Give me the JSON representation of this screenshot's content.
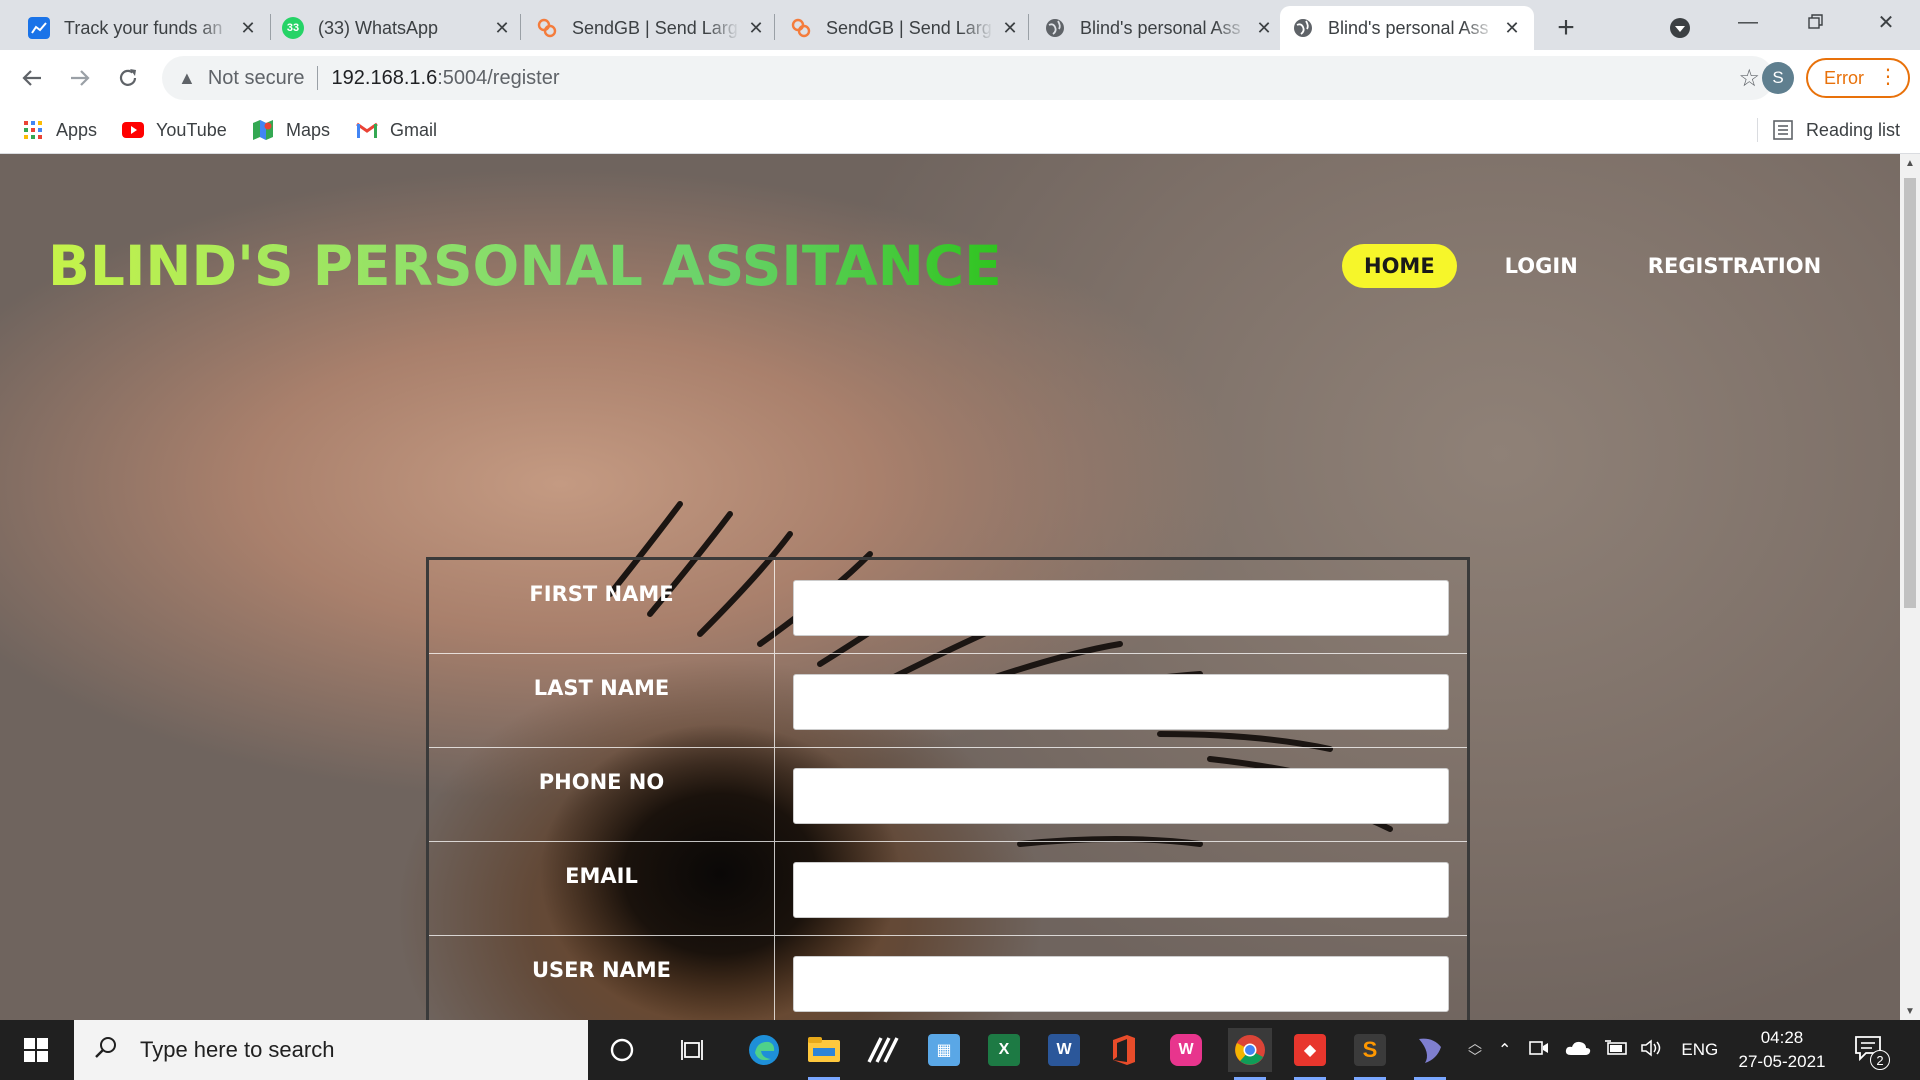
{
  "browser": {
    "tabs": [
      {
        "title": "Track your funds an",
        "favicon": "chart-favicon",
        "color": "#1a73e8",
        "active": false
      },
      {
        "title": "(33) WhatsApp",
        "favicon": "whatsapp-favicon",
        "badge": "33",
        "color": "#25d366",
        "active": false
      },
      {
        "title": "SendGB | Send Larg",
        "favicon": "sendgb-favicon",
        "color": "#f47c3c",
        "active": false
      },
      {
        "title": "SendGB | Send Larg",
        "favicon": "sendgb-favicon",
        "color": "#f47c3c",
        "active": false
      },
      {
        "title": "Blind's personal Ass",
        "favicon": "globe-favicon",
        "color": "#5f6368",
        "active": false
      },
      {
        "title": "Blind's personal Ass",
        "favicon": "globe-favicon",
        "color": "#5f6368",
        "active": true
      }
    ],
    "address": {
      "security": "Not secure",
      "host": "192.168.1.6",
      "path": ":5004/register"
    },
    "profile_initial": "S",
    "error_label": "Error",
    "bookmarks": [
      {
        "label": "Apps",
        "icon": "apps-grid-icon"
      },
      {
        "label": "YouTube",
        "icon": "youtube-icon"
      },
      {
        "label": "Maps",
        "icon": "maps-icon"
      },
      {
        "label": "Gmail",
        "icon": "gmail-icon"
      }
    ],
    "reading_list": "Reading list"
  },
  "page": {
    "title": "BLIND'S PERSONAL ASSITANCE",
    "nav": [
      {
        "label": "HOME",
        "active": true
      },
      {
        "label": "LOGIN",
        "active": false
      },
      {
        "label": "REGISTRATION",
        "active": false
      }
    ],
    "form": {
      "fields": [
        {
          "label": "FIRST NAME",
          "value": ""
        },
        {
          "label": "LAST NAME",
          "value": ""
        },
        {
          "label": "PHONE NO",
          "value": ""
        },
        {
          "label": "EMAIL",
          "value": ""
        },
        {
          "label": "USER NAME",
          "value": ""
        }
      ]
    },
    "colors": {
      "nav_active_bg": "#f6f62a",
      "title_gradient_start": "#c6f34a",
      "title_gradient_end": "#2fc41f"
    }
  },
  "taskbar": {
    "search_placeholder": "Type here to search",
    "apps": [
      "cortana-icon",
      "task-view-icon",
      "edge-icon",
      "file-explorer-icon",
      "app-icon",
      "control-panel-icon",
      "excel-icon",
      "word-icon",
      "office-icon",
      "wamp-icon",
      "chrome-icon",
      "git-icon",
      "sublime-icon",
      "app-icon"
    ],
    "language": "ENG",
    "time": "04:28",
    "date": "27-05-2021",
    "notification_count": "2"
  }
}
